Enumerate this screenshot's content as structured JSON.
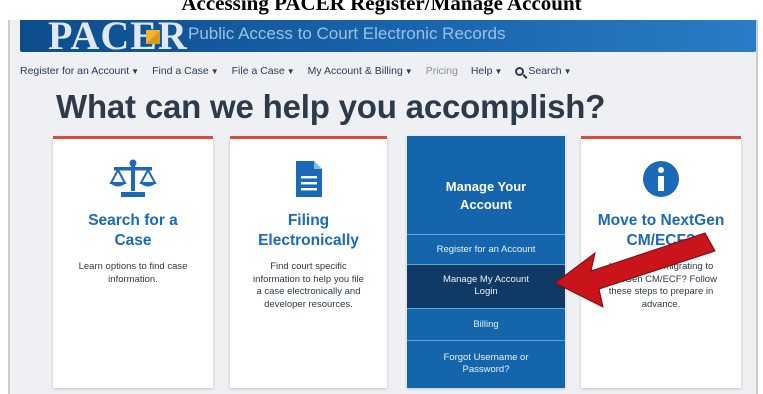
{
  "caption": "Accessing PACER Register/Manage Account",
  "header": {
    "logo_text": "PACER",
    "tagline": "Public Access to Court Electronic Records"
  },
  "nav": {
    "items": [
      {
        "label": "Register for an Account",
        "dropdown": true
      },
      {
        "label": "Find a Case",
        "dropdown": true
      },
      {
        "label": "File a Case",
        "dropdown": true
      },
      {
        "label": "My Account & Billing",
        "dropdown": true
      },
      {
        "label": "Pricing",
        "dropdown": false
      },
      {
        "label": "Help",
        "dropdown": true
      }
    ],
    "search_label": "Search"
  },
  "headline": "What can we help you accomplish?",
  "cards": {
    "search": {
      "icon": "scales-icon",
      "title_line1": "Search for a",
      "title_line2": "Case",
      "text": "Learn options to find case information."
    },
    "filing": {
      "icon": "document-icon",
      "title_line1": "Filing",
      "title_line2": "Electronically",
      "text": "Find court specific information to help you file a case electronically and developer resources."
    },
    "nextgen": {
      "icon": "info-icon",
      "title_line1": "Move to NextGen",
      "title_line2": "CM/ECF?",
      "text": "Is your court migrating to NextGen CM/ECF? Follow these steps to prepare in advance."
    }
  },
  "manage": {
    "title_line1": "Manage Your",
    "title_line2": "Account",
    "links": {
      "register": "Register for an Account",
      "manage_line1": "Manage My Account",
      "manage_line2": "Login",
      "billing": "Billing",
      "forgot_line1": "Forgot Username or",
      "forgot_line2": "Password?"
    }
  },
  "colors": {
    "brand_blue": "#1565ad",
    "card_title_blue": "#1a6ab8",
    "card_top_red": "#d94b3d",
    "arrow_red": "#c8141a"
  }
}
